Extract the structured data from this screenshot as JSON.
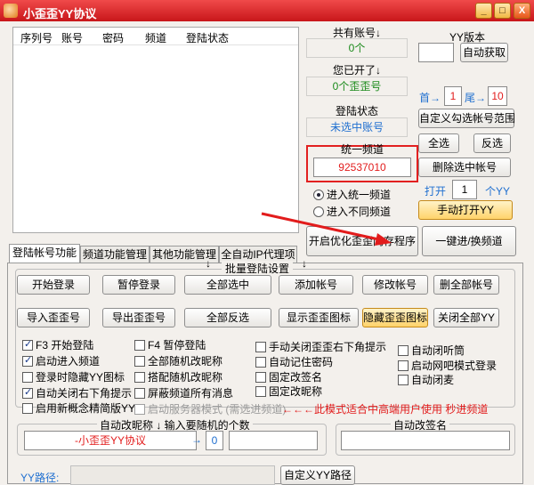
{
  "titlebar": {
    "title": "小歪歪YY协议",
    "min_label": "_",
    "max_label": "□",
    "close_label": "X"
  },
  "table": {
    "headers": [
      "序列号",
      "账号",
      "密码",
      "频道",
      "登陆状态"
    ]
  },
  "account_count": {
    "label": "共有账号↓",
    "value": "0个"
  },
  "opened": {
    "label": "您已开了↓",
    "value": "0个歪歪号"
  },
  "login_status": {
    "label": "登陆状态",
    "value": "未选中账号"
  },
  "unified_channel": {
    "label": "统一频道",
    "value": "92537010"
  },
  "channel_mode": {
    "option1": "进入统一频道",
    "option2": "进入不同频道"
  },
  "yy_version": {
    "label": "YY版本",
    "value": "",
    "auto_get": "自动获取"
  },
  "range": {
    "first_label": "首→",
    "first_value": "1",
    "last_label": "尾→",
    "last_value": "10"
  },
  "right_buttons": {
    "custom_range": "自定义勾选帐号范围",
    "select_all": "全选",
    "invert": "反选",
    "delete_selected": "删除选中帐号",
    "open_label": "打开",
    "open_value": "1",
    "open_unit": "个YY",
    "manual_open": "手动打开YY"
  },
  "bottom_actions": {
    "optimize": "开启优化歪歪内存程序",
    "join": "一键进/换频道"
  },
  "tabs": [
    "登陆帐号功能",
    "频道功能管理",
    "其他功能管理",
    "全自动IP代理项"
  ],
  "batch": {
    "title": "批量登陆设置",
    "row1": [
      "开始登录",
      "暂停登录",
      "全部选中",
      "添加帐号",
      "修改帐号",
      "删全部帐号"
    ],
    "row2": [
      "导入歪歪号",
      "导出歪歪号",
      "全部反选",
      "显示歪歪图标",
      "隐藏歪歪图标",
      "关闭全部YY"
    ]
  },
  "options": {
    "col1": [
      {
        "label": "F3 开始登陆",
        "checked": true
      },
      {
        "label": "启动进入频道",
        "checked": true
      },
      {
        "label": "登录时隐藏YY图标",
        "checked": false
      },
      {
        "label": "自动关闭右下角提示",
        "checked": true
      },
      {
        "label": "启用新概念精简版YY",
        "checked": false
      }
    ],
    "col2": [
      {
        "label": "F4 暂停登陆",
        "checked": false
      },
      {
        "label": "全部随机改昵称",
        "checked": false
      },
      {
        "label": "搭配随机改昵称",
        "checked": false
      },
      {
        "label": "屏蔽频道所有消息",
        "checked": false
      }
    ],
    "col3": [
      {
        "label": "手动关闭歪歪右下角提示",
        "checked": false
      },
      {
        "label": "自动记住密码",
        "checked": false
      },
      {
        "label": "固定改签名",
        "checked": false
      },
      {
        "label": "固定改昵称",
        "checked": false
      }
    ],
    "col4": [
      {
        "label": "自动闭听筒",
        "checked": false
      },
      {
        "label": "启动网吧模式登录",
        "checked": false
      },
      {
        "label": "自动闭麦",
        "checked": false
      }
    ],
    "server_mode": "启动服务器模式 (需选进频道)",
    "server_note": "←←←此模式适合中高端用户使用 秒进频道"
  },
  "nickname": {
    "label": "自动改昵称 ↓ 输入要随机的个数",
    "value": "-小歪歪YY协议",
    "arrow": "→",
    "random_count": "0",
    "extra": ""
  },
  "signature": {
    "label": "自动改签名",
    "value": ""
  },
  "yy_path": {
    "label": "YY路径:",
    "value": "",
    "button": "自定义YY路径"
  },
  "colors": {
    "accent_red": "#e21c1c",
    "title_bar": "#d42020",
    "green_text": "#1a8a1a",
    "blue_text": "#1f6fd0",
    "highlight_box": "#e22020"
  }
}
